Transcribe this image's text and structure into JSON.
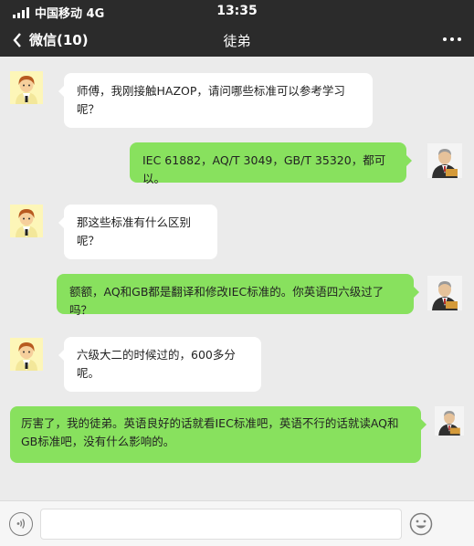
{
  "status_bar": {
    "carrier": "中国移动 4G",
    "time": "13:35"
  },
  "nav": {
    "back_label": "微信(10)",
    "title": "徒弟"
  },
  "messages": [
    {
      "side": "left",
      "sender": "apprentice",
      "text": "师傅，我刚接触HAZOP，请问哪些标准可以参考学习呢？"
    },
    {
      "side": "right",
      "sender": "master",
      "text": "IEC 61882，AQ/T 3049，GB/T 35320，都可以。"
    },
    {
      "side": "left",
      "sender": "apprentice",
      "text": "那这些标准有什么区别呢？"
    },
    {
      "side": "right",
      "sender": "master",
      "text": "额额，AQ和GB都是翻译和修改IEC标准的。你英语四六级过了吗？"
    },
    {
      "side": "left",
      "sender": "apprentice",
      "text": "六级大二的时候过的，600多分呢。"
    },
    {
      "side": "right",
      "sender": "master",
      "text": "厉害了，我的徒弟。英语良好的话就看IEC标准吧，英语不行的话就读AQ和GB标准吧，没有什么影响的。"
    }
  ],
  "colors": {
    "top_bar": "#2b2b2b",
    "chat_background": "#ebebeb",
    "sent_bubble": "#88e15e",
    "received_bubble": "#ffffff"
  },
  "icons": {
    "back": "chevron-left-icon",
    "more": "more-dots-icon",
    "voice": "voice-icon",
    "emoji": "emoji-icon"
  }
}
